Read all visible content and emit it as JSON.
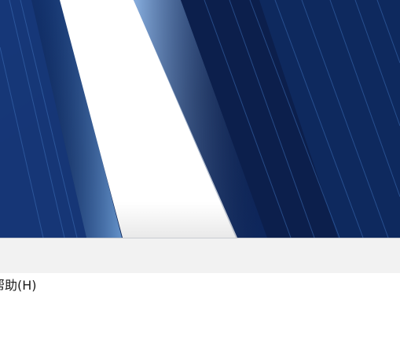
{
  "desktop": {
    "wallpaper": "windows-light-beam-wallpaper",
    "colors": {
      "deep_navy": "#0b1f4a",
      "mid_blue": "#1a3f80",
      "light_beam": "#ffffff"
    }
  },
  "window": {
    "titlebar_color": "#f2f2f2",
    "menubar": {
      "items": [
        {
          "label": "帮助(H)"
        }
      ]
    }
  }
}
